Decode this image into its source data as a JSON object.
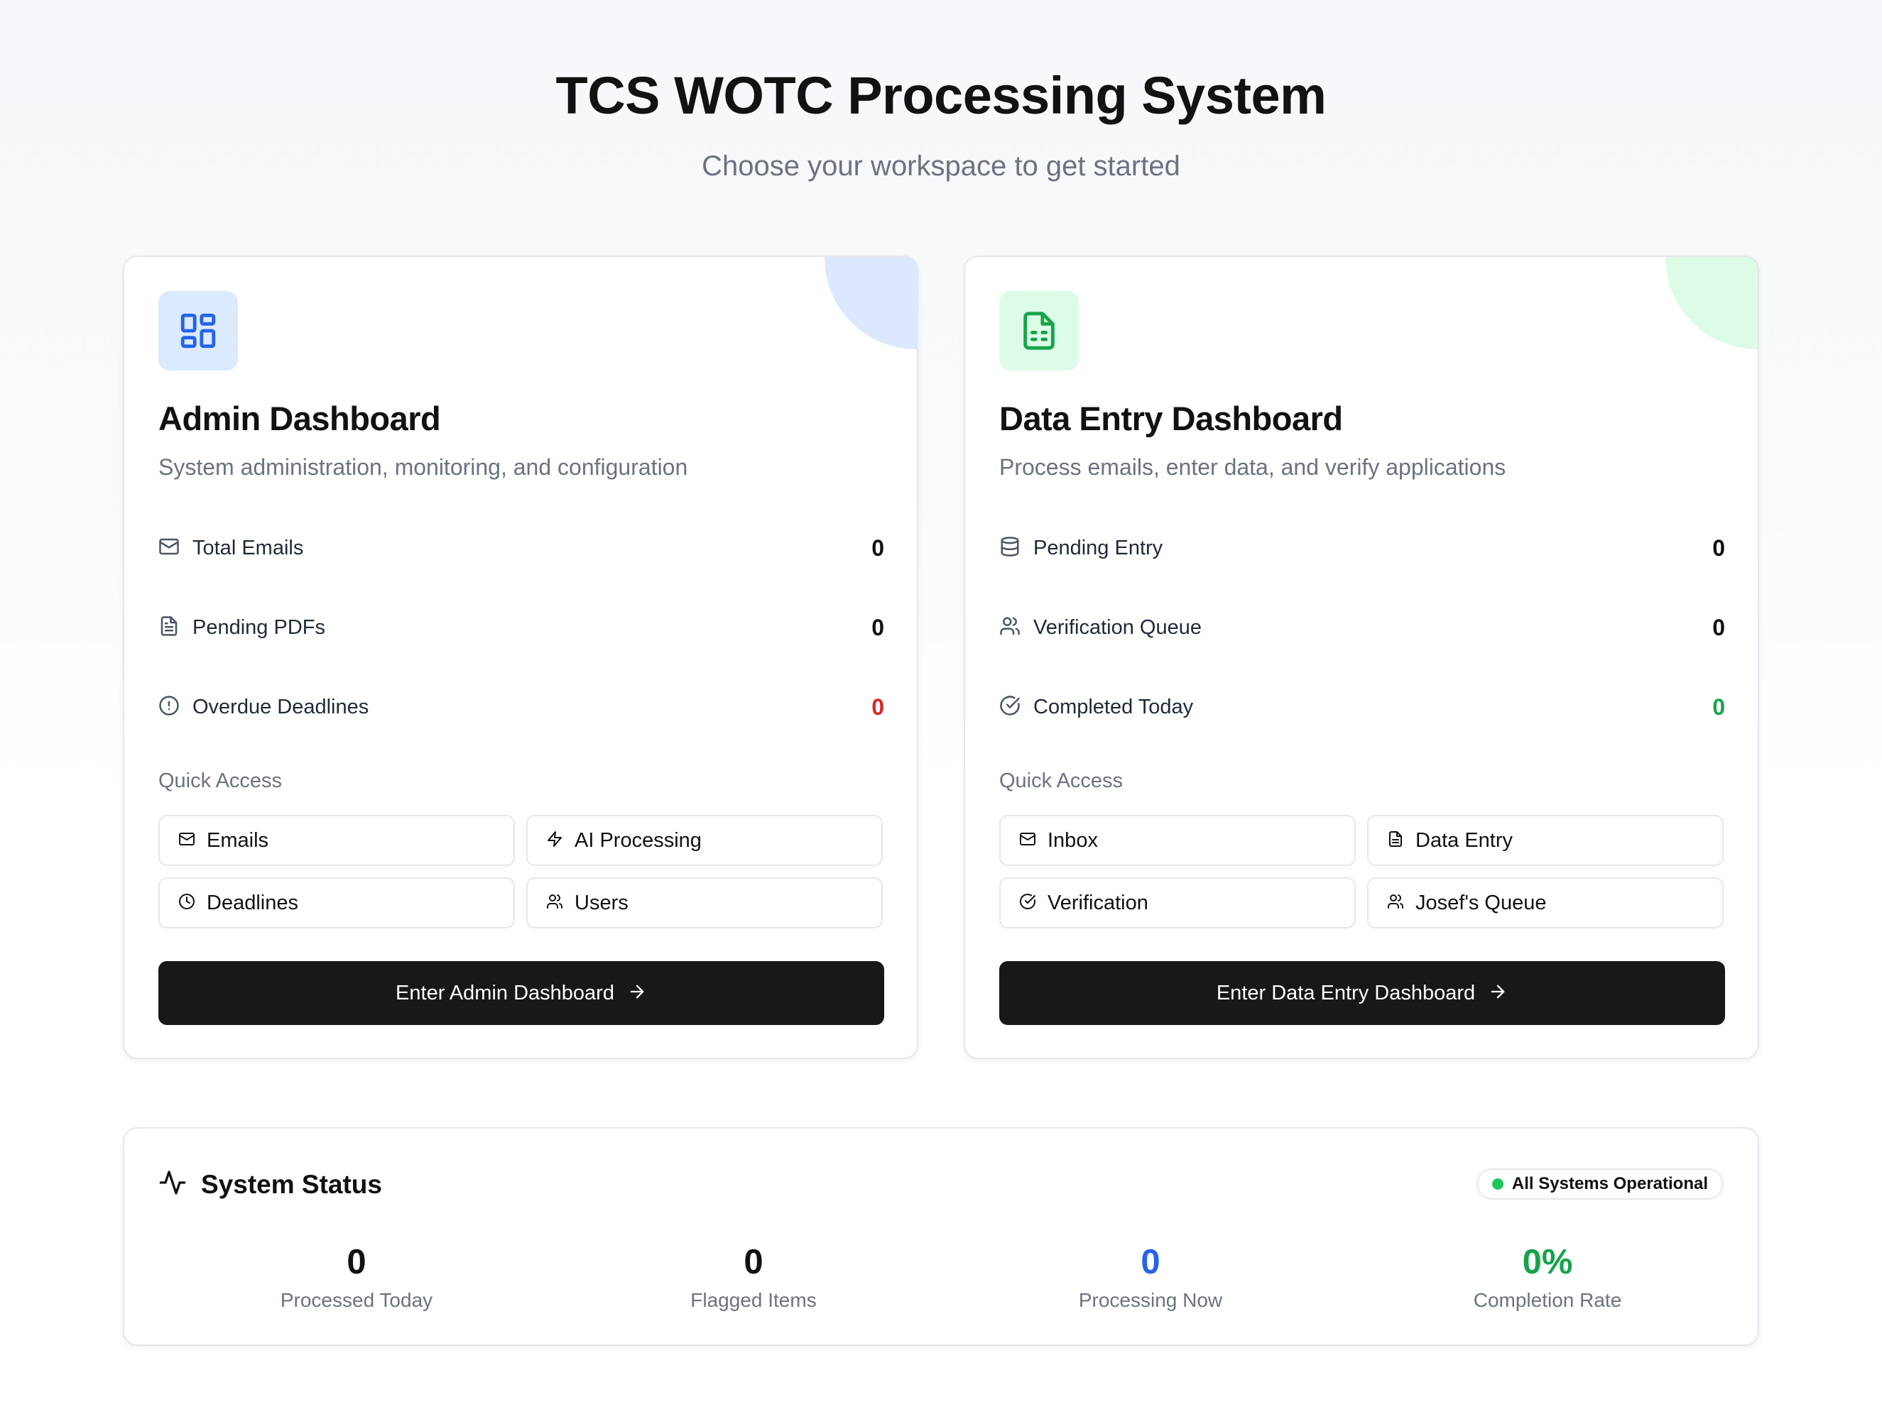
{
  "header": {
    "title": "TCS WOTC Processing System",
    "subtitle": "Choose your workspace to get started"
  },
  "admin": {
    "icon": "layout-dashboard-icon",
    "accent": "#2563eb",
    "title": "Admin Dashboard",
    "description": "System administration, monitoring, and configuration",
    "stats": [
      {
        "icon": "mail-icon",
        "label": "Total Emails",
        "value": "0"
      },
      {
        "icon": "file-text-icon",
        "label": "Pending PDFs",
        "value": "0"
      },
      {
        "icon": "alert-circle-icon",
        "label": "Overdue Deadlines",
        "value": "0",
        "color": "#dc2626"
      }
    ],
    "quick_access_label": "Quick Access",
    "quick_access": [
      {
        "icon": "mail-icon",
        "label": "Emails"
      },
      {
        "icon": "zap-icon",
        "label": "AI Processing"
      },
      {
        "icon": "clock-icon",
        "label": "Deadlines"
      },
      {
        "icon": "users-icon",
        "label": "Users"
      }
    ],
    "enter_label": "Enter Admin Dashboard"
  },
  "data_entry": {
    "icon": "file-spreadsheet-icon",
    "accent": "#16a34a",
    "title": "Data Entry Dashboard",
    "description": "Process emails, enter data, and verify applications",
    "stats": [
      {
        "icon": "database-icon",
        "label": "Pending Entry",
        "value": "0"
      },
      {
        "icon": "users-icon",
        "label": "Verification Queue",
        "value": "0"
      },
      {
        "icon": "check-circle-icon",
        "label": "Completed Today",
        "value": "0",
        "color": "#16a34a"
      }
    ],
    "quick_access_label": "Quick Access",
    "quick_access": [
      {
        "icon": "mail-icon",
        "label": "Inbox"
      },
      {
        "icon": "file-text-icon",
        "label": "Data Entry"
      },
      {
        "icon": "check-circle-icon",
        "label": "Verification"
      },
      {
        "icon": "users-icon",
        "label": "Josef's Queue"
      }
    ],
    "enter_label": "Enter Data Entry Dashboard"
  },
  "system_status": {
    "icon": "activity-icon",
    "title": "System Status",
    "badge": "All Systems Operational",
    "badge_color": "#22c55e",
    "metrics": [
      {
        "value": "0",
        "label": "Processed Today"
      },
      {
        "value": "0",
        "label": "Flagged Items"
      },
      {
        "value": "0",
        "label": "Processing Now",
        "color": "#2563eb"
      },
      {
        "value": "0%",
        "label": "Completion Rate",
        "color": "#16a34a"
      }
    ]
  }
}
